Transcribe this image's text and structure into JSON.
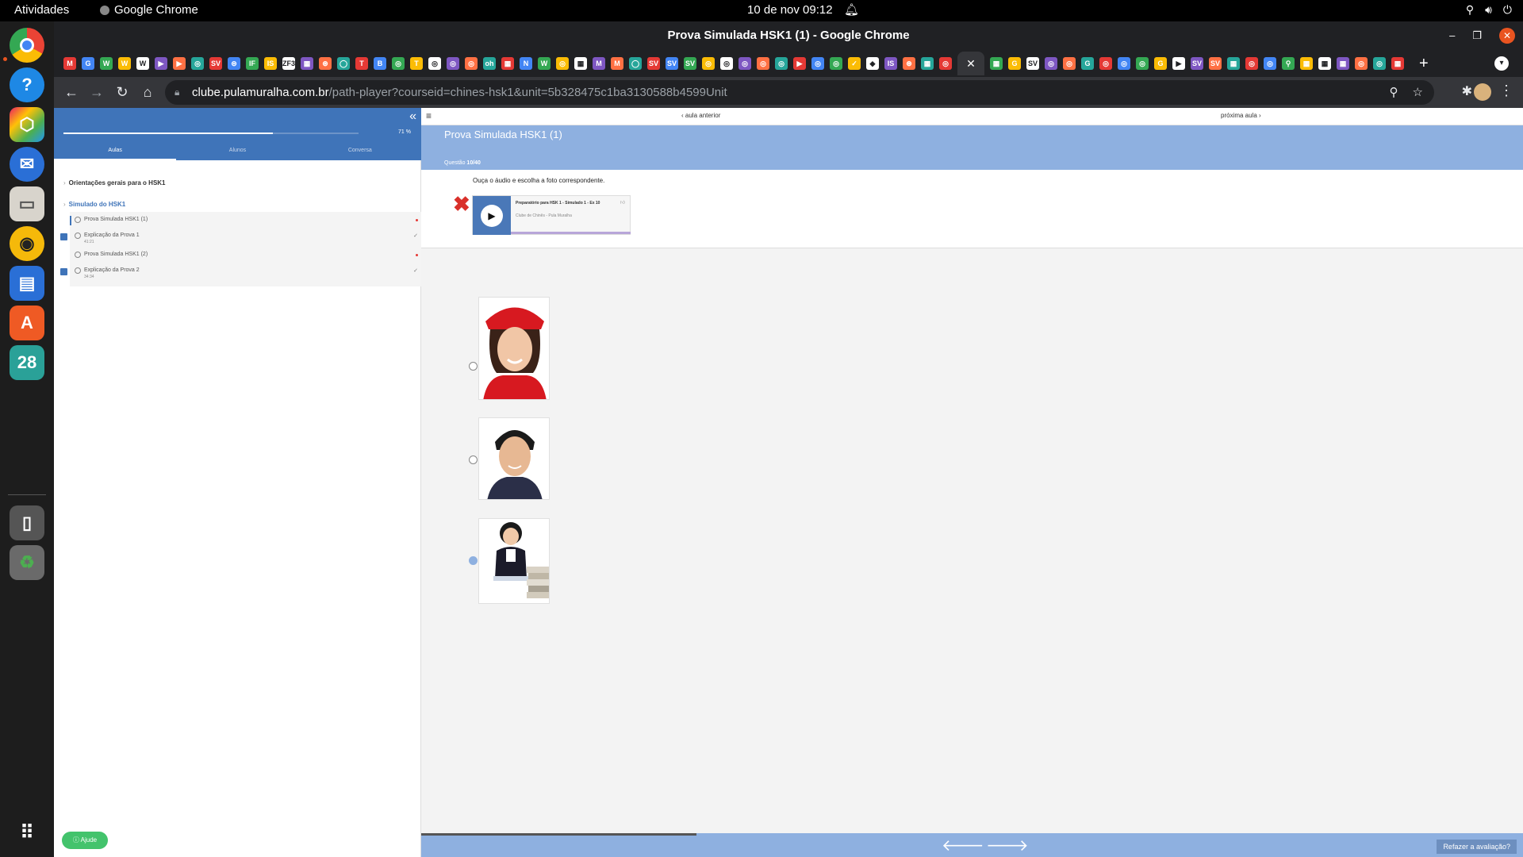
{
  "system": {
    "activities": "Atividades",
    "app_name": "Google Chrome",
    "clock": "10 de nov  09:12"
  },
  "dock": {
    "calendar_day": "28"
  },
  "window": {
    "title": "Prova Simulada HSK1 (1) - Google Chrome"
  },
  "browser": {
    "url_host": "clube.pulamuralha.com.br",
    "url_path": "/path-player?courseid=chines-hsk1&unit=5b328475c1ba3130588b4599Unit",
    "favicons": [
      "M",
      "G",
      "W",
      "W",
      "W",
      "▶",
      "▶",
      "◎",
      "SV",
      "⊜",
      "IF",
      "IS",
      "ZF3",
      "▦",
      "⊛",
      "◯",
      "T",
      "B",
      "◎",
      "T",
      "◎",
      "◎",
      "◎",
      "oh",
      "▦",
      "N",
      "W",
      "◎",
      "▦",
      "M",
      "M",
      "◯",
      "SV",
      "SV",
      "SV",
      "◎",
      "◎",
      "◎",
      "◎",
      "◎",
      "▶",
      "◎",
      "◎",
      "✓",
      "◆",
      "IS",
      "⊛",
      "▦",
      "◎",
      "✕",
      "▦",
      "G",
      "SV",
      "◎",
      "◎",
      "G",
      "◎",
      "◎",
      "◎",
      "G",
      "▶",
      "SV",
      "SV",
      "▦",
      "◎",
      "◎",
      "⚲",
      "▦",
      "▦",
      "▦",
      "◎",
      "◎",
      "▦"
    ],
    "accent": "#35363a"
  },
  "sidebar": {
    "progress_percent": 71,
    "progress_label": "71 %",
    "tabs": [
      "Aulas",
      "Alunos",
      "Conversa"
    ],
    "sections": [
      {
        "label": "Orientações gerais para o HSK1"
      },
      {
        "label": "Simulado do HSK1"
      }
    ],
    "lessons": [
      {
        "title": "Prova Simulada HSK1 (1)",
        "duration": "",
        "status": "pending"
      },
      {
        "title": "Explicação da Prova 1",
        "duration": "41:21",
        "status": "done"
      },
      {
        "title": "Prova Simulada HSK1 (2)",
        "duration": "",
        "status": "pending"
      },
      {
        "title": "Explicação da Prova 2",
        "duration": "34:34",
        "status": "done"
      }
    ],
    "help_label": "Ajude",
    "accent": "#3f74b9"
  },
  "main": {
    "prev_label": "aula anterior",
    "next_label": "próxima aula",
    "title": "Prova Simulada HSK1 (1)",
    "question_prefix": "Questão",
    "question_number": "10/40",
    "prompt": "Ouça o áudio e escolha a foto correspondente.",
    "player": {
      "title": "Preparatório para HSK 1 - Simulado 1 - Ex 10",
      "subtitle": "Clube de Chinês - Pula Muralha"
    },
    "options": [
      {
        "image": "woman-red-hat-photo",
        "selected": false
      },
      {
        "image": "young-man-photo",
        "selected": false
      },
      {
        "image": "girl-studying-books-photo",
        "selected": true
      }
    ],
    "redo_label": "Refazer a avaliação?",
    "header_color": "#8eb0e0"
  }
}
